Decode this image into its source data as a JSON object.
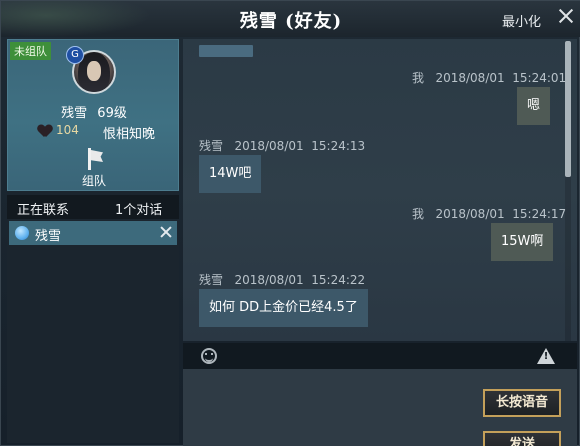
{
  "window": {
    "title": "残雪 (好友)",
    "minimize_label": "最小化"
  },
  "profile": {
    "team_status": "未组队",
    "badge_glyph": "G",
    "name": "残雪",
    "level": "69级",
    "intimacy": "104",
    "relation": "恨相知晚",
    "team_button_label": "组队"
  },
  "contacts": {
    "header_label": "正在联系",
    "count_label": "1个对话",
    "items": [
      {
        "name": "残雪"
      }
    ]
  },
  "chat": {
    "messages": [
      {
        "sender": "我",
        "time": "2018/08/01  15:24:01",
        "text": "嗯",
        "side": "me"
      },
      {
        "sender": "残雪",
        "time": "2018/08/01  15:24:13",
        "text": "14W吧",
        "side": "friend"
      },
      {
        "sender": "我",
        "time": "2018/08/01  15:24:17",
        "text": "15W啊",
        "side": "me"
      },
      {
        "sender": "残雪",
        "time": "2018/08/01  15:24:22",
        "text": "如何  DD上金价已经4.5了",
        "side": "friend"
      }
    ]
  },
  "input": {
    "voice_button": "长按语音",
    "send_button": "发送"
  },
  "colors": {
    "accent_gold": "#c4a05a",
    "team_tag_green": "#3e8f3a",
    "selected_contact": "#3d6a7c"
  },
  "icons": [
    "close-icon",
    "shield-badge-icon",
    "heart-icon",
    "flag-icon",
    "contact-status-icon",
    "emoji-icon",
    "warning-icon"
  ]
}
